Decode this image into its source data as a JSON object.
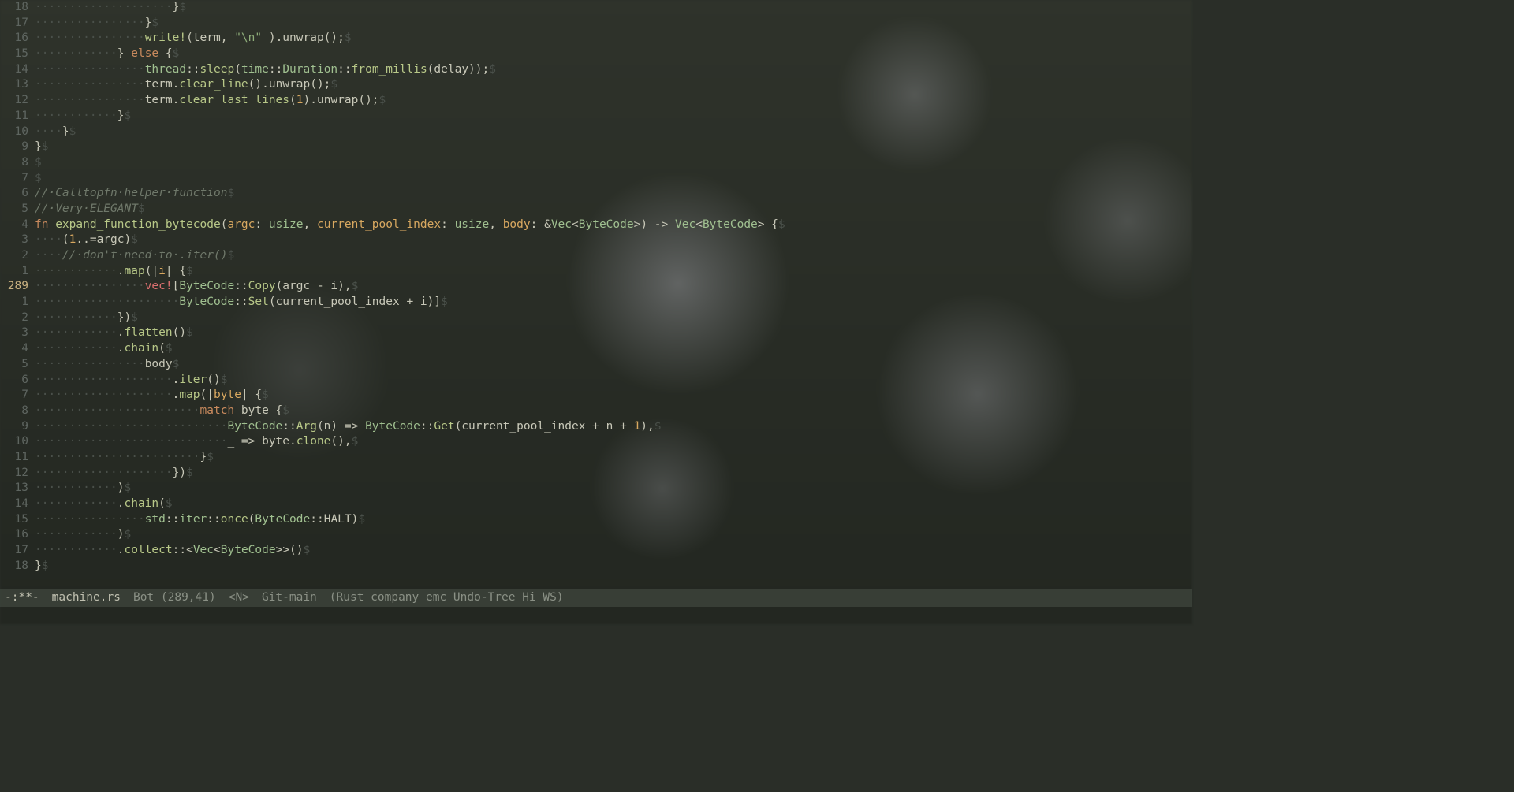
{
  "modeline": {
    "modified": "-:**-",
    "filename": "machine.rs",
    "position": "Bot (289,41)",
    "mode_indicator": "<N>",
    "vc": "Git-main",
    "modes": "(Rust company emc Undo-Tree Hi WS)"
  },
  "cursor": {
    "line": 289,
    "col": 41
  },
  "lines": [
    {
      "n": "18",
      "indent": 20,
      "tokens": [
        [
          "",
          "}"
        ]
      ]
    },
    {
      "n": "17",
      "indent": 16,
      "tokens": [
        [
          "",
          "}"
        ]
      ]
    },
    {
      "n": "16",
      "indent": 16,
      "tokens": [
        [
          "fn",
          "write!"
        ],
        [
          "",
          "(term, "
        ],
        [
          "str",
          "\"\\n\""
        ],
        [
          "",
          " ).unwrap();"
        ]
      ]
    },
    {
      "n": "15",
      "indent": 12,
      "tokens": [
        [
          "",
          "} "
        ],
        [
          "kw",
          "else"
        ],
        [
          "",
          " {"
        ]
      ]
    },
    {
      "n": "14",
      "indent": 16,
      "tokens": [
        [
          "type",
          "thread"
        ],
        [
          "",
          "::"
        ],
        [
          "fn",
          "sleep"
        ],
        [
          "",
          "("
        ],
        [
          "type",
          "time"
        ],
        [
          "",
          "::"
        ],
        [
          "type",
          "Duration"
        ],
        [
          "",
          "::"
        ],
        [
          "fn",
          "from_millis"
        ],
        [
          "",
          "(delay));"
        ]
      ]
    },
    {
      "n": "13",
      "indent": 16,
      "tokens": [
        [
          "",
          "term."
        ],
        [
          "fn",
          "clear_line"
        ],
        [
          "",
          "().unwrap();"
        ]
      ]
    },
    {
      "n": "12",
      "indent": 16,
      "tokens": [
        [
          "",
          "term."
        ],
        [
          "fn",
          "clear_last_lines"
        ],
        [
          "",
          "("
        ],
        [
          "num",
          "1"
        ],
        [
          "",
          ").unwrap();"
        ]
      ]
    },
    {
      "n": "11",
      "indent": 12,
      "tokens": [
        [
          "",
          "}"
        ]
      ]
    },
    {
      "n": "10",
      "indent": 4,
      "tokens": [
        [
          "",
          "}"
        ]
      ]
    },
    {
      "n": "9",
      "indent": 0,
      "tokens": [
        [
          "",
          "}"
        ]
      ]
    },
    {
      "n": "8",
      "indent": 0,
      "tokens": []
    },
    {
      "n": "7",
      "indent": 0,
      "tokens": []
    },
    {
      "n": "6",
      "indent": 0,
      "tokens": [
        [
          "comment",
          "// Calltopfn helper function"
        ]
      ]
    },
    {
      "n": "5",
      "indent": 0,
      "tokens": [
        [
          "comment",
          "// Very ELEGANT"
        ]
      ]
    },
    {
      "n": "4",
      "indent": 0,
      "tokens": [
        [
          "kw",
          "fn"
        ],
        [
          "",
          " "
        ],
        [
          "fn",
          "expand_function_bytecode"
        ],
        [
          "",
          "("
        ],
        [
          "param",
          "argc"
        ],
        [
          "",
          ": "
        ],
        [
          "type",
          "usize"
        ],
        [
          "",
          ", "
        ],
        [
          "param",
          "current_pool_index"
        ],
        [
          "",
          ": "
        ],
        [
          "type",
          "usize"
        ],
        [
          "",
          ", "
        ],
        [
          "param",
          "body"
        ],
        [
          "",
          ": &"
        ],
        [
          "type",
          "Vec"
        ],
        [
          "",
          "<"
        ],
        [
          "type",
          "ByteCode"
        ],
        [
          "",
          ">) -> "
        ],
        [
          "type",
          "Vec"
        ],
        [
          "",
          "<"
        ],
        [
          "type",
          "ByteCode"
        ],
        [
          "",
          "> {"
        ]
      ]
    },
    {
      "n": "3",
      "indent": 4,
      "tokens": [
        [
          "",
          "("
        ],
        [
          "num",
          "1"
        ],
        [
          "",
          "..="
        ],
        [
          "",
          "argc)"
        ]
      ]
    },
    {
      "n": "2",
      "indent": 4,
      "tokens": [
        [
          "comment",
          "// don't need to .iter()"
        ]
      ]
    },
    {
      "n": "1",
      "indent": 12,
      "tokens": [
        [
          "",
          "."
        ],
        [
          "fn",
          "map"
        ],
        [
          "",
          "(|"
        ],
        [
          "param",
          "i"
        ],
        [
          "",
          "| {"
        ]
      ]
    },
    {
      "n": "289",
      "curr": true,
      "indent": 16,
      "tokens": [
        [
          "kw2",
          "vec!"
        ],
        [
          "",
          "["
        ],
        [
          "type",
          "ByteCode"
        ],
        [
          "",
          "::"
        ],
        [
          "fn",
          "Copy"
        ],
        [
          "",
          "(argc - i),"
        ]
      ]
    },
    {
      "n": "1",
      "indent": 21,
      "tokens": [
        [
          "type",
          "ByteCode"
        ],
        [
          "",
          "::"
        ],
        [
          "fn",
          "Set"
        ],
        [
          "",
          "(current_pool_index + i)]"
        ]
      ]
    },
    {
      "n": "2",
      "indent": 12,
      "tokens": [
        [
          "",
          "})"
        ]
      ]
    },
    {
      "n": "3",
      "indent": 12,
      "tokens": [
        [
          "",
          "."
        ],
        [
          "fn",
          "flatten"
        ],
        [
          "",
          "()"
        ]
      ]
    },
    {
      "n": "4",
      "indent": 12,
      "tokens": [
        [
          "",
          "."
        ],
        [
          "fn",
          "chain"
        ],
        [
          "",
          "("
        ]
      ]
    },
    {
      "n": "5",
      "indent": 16,
      "tokens": [
        [
          "",
          "body"
        ]
      ]
    },
    {
      "n": "6",
      "indent": 20,
      "tokens": [
        [
          "",
          "."
        ],
        [
          "fn",
          "iter"
        ],
        [
          "",
          "()"
        ]
      ]
    },
    {
      "n": "7",
      "indent": 20,
      "tokens": [
        [
          "",
          "."
        ],
        [
          "fn",
          "map"
        ],
        [
          "",
          "(|"
        ],
        [
          "param",
          "byte"
        ],
        [
          "",
          "| {"
        ]
      ]
    },
    {
      "n": "8",
      "indent": 24,
      "tokens": [
        [
          "kw",
          "match"
        ],
        [
          "",
          " byte {"
        ]
      ]
    },
    {
      "n": "9",
      "indent": 28,
      "tokens": [
        [
          "type",
          "ByteCode"
        ],
        [
          "",
          "::"
        ],
        [
          "fn",
          "Arg"
        ],
        [
          "",
          "(n) => "
        ],
        [
          "type",
          "ByteCode"
        ],
        [
          "",
          "::"
        ],
        [
          "fn",
          "Get"
        ],
        [
          "",
          "(current_pool_index + n + "
        ],
        [
          "num",
          "1"
        ],
        [
          "",
          "),"
        ]
      ]
    },
    {
      "n": "10",
      "indent": 28,
      "tokens": [
        [
          "",
          "_ => byte."
        ],
        [
          "fn",
          "clone"
        ],
        [
          "",
          "(),"
        ]
      ]
    },
    {
      "n": "11",
      "indent": 24,
      "tokens": [
        [
          "",
          "}"
        ]
      ]
    },
    {
      "n": "12",
      "indent": 20,
      "tokens": [
        [
          "",
          "})"
        ]
      ]
    },
    {
      "n": "13",
      "indent": 12,
      "tokens": [
        [
          "",
          ")"
        ]
      ]
    },
    {
      "n": "14",
      "indent": 12,
      "tokens": [
        [
          "",
          "."
        ],
        [
          "fn",
          "chain"
        ],
        [
          "",
          "("
        ]
      ]
    },
    {
      "n": "15",
      "indent": 16,
      "tokens": [
        [
          "type",
          "std"
        ],
        [
          "",
          "::"
        ],
        [
          "type",
          "iter"
        ],
        [
          "",
          "::"
        ],
        [
          "fn",
          "once"
        ],
        [
          "",
          "("
        ],
        [
          "type",
          "ByteCode"
        ],
        [
          "",
          "::"
        ],
        [
          "",
          "HALT)"
        ]
      ]
    },
    {
      "n": "16",
      "indent": 12,
      "tokens": [
        [
          "",
          ")"
        ]
      ]
    },
    {
      "n": "17",
      "indent": 12,
      "tokens": [
        [
          "",
          "."
        ],
        [
          "fn",
          "collect"
        ],
        [
          "",
          "::<"
        ],
        [
          "type",
          "Vec"
        ],
        [
          "",
          "<"
        ],
        [
          "type",
          "ByteCode"
        ],
        [
          "",
          ">>()"
        ]
      ]
    },
    {
      "n": "18",
      "indent": 0,
      "tokens": [
        [
          "",
          "}"
        ]
      ]
    }
  ]
}
